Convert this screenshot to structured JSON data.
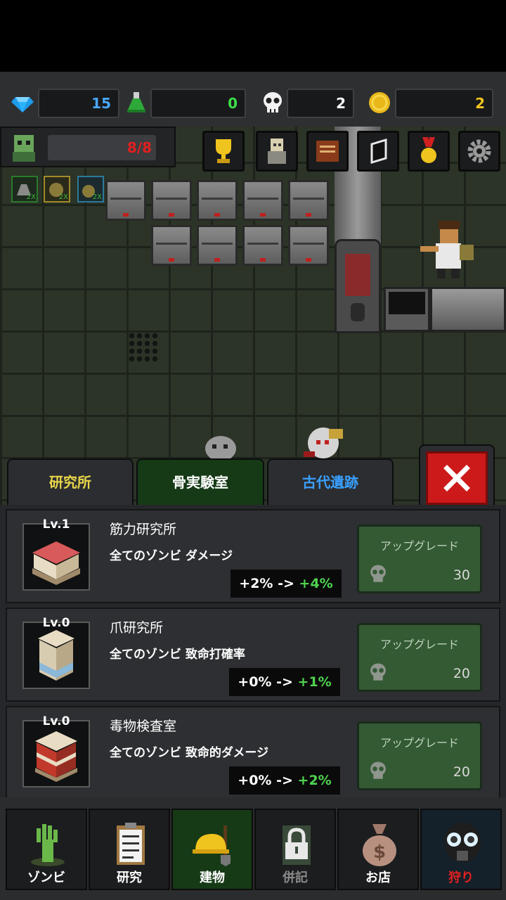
{
  "resources": {
    "gems": "15",
    "potion": "0",
    "skulls": "2",
    "coins": "2"
  },
  "zombie_count": "8/8",
  "buffs": [
    "2X",
    "2X",
    "2X"
  ],
  "tabs": [
    {
      "label": "研究所",
      "color": "#e8d54a"
    },
    {
      "label": "骨実験室",
      "color": "#ffffff"
    },
    {
      "label": "古代遺跡",
      "color": "#3aa0ff"
    }
  ],
  "close_icon": "close-icon",
  "buildings": [
    {
      "level": "Lv.1",
      "name": "筋力研究所",
      "desc": "全てのゾンビ ダメージ",
      "cur": "+2%",
      "arrow": "->",
      "next": "+4%",
      "upgrade_label": "アップグレード",
      "cost": "30"
    },
    {
      "level": "Lv.0",
      "name": "爪研究所",
      "desc": "全てのゾンビ 致命打確率",
      "cur": "+0%",
      "arrow": "->",
      "next": "+1%",
      "upgrade_label": "アップグレード",
      "cost": "20"
    },
    {
      "level": "Lv.0",
      "name": "毒物検査室",
      "desc": "全てのゾンビ 致命的ダメージ",
      "cur": "+0%",
      "arrow": "->",
      "next": "+2%",
      "upgrade_label": "アップグレード",
      "cost": "20"
    }
  ],
  "nav": [
    {
      "label": "ゾンビ",
      "icon": "zombie-hand-icon",
      "color": "#ffffff"
    },
    {
      "label": "研究",
      "icon": "clipboard-icon",
      "color": "#ffffff"
    },
    {
      "label": "建物",
      "icon": "hardhat-shovel-icon",
      "color": "#ffffff"
    },
    {
      "label": "併記",
      "icon": "locked-icon",
      "color": "#8a8a8a"
    },
    {
      "label": "お店",
      "icon": "money-bag-icon",
      "color": "#ffffff"
    },
    {
      "label": "狩り",
      "icon": "gas-mask-icon",
      "color": "#e02020"
    }
  ]
}
